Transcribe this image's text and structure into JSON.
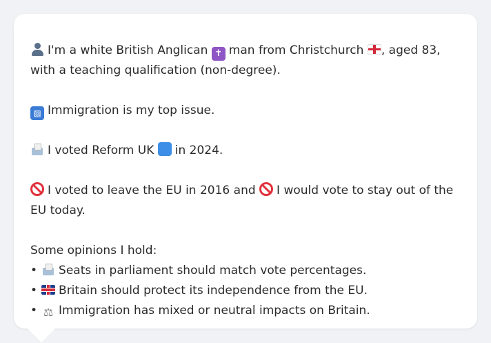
{
  "profile": {
    "line1_part1": "I'm a white British Anglican",
    "line1_part2": "man from Christchurch",
    "line1_part3": ", aged 83, with a teaching qualification (non-degree).",
    "issue": "Immigration is my top issue.",
    "vote_part1": "I voted Reform UK",
    "vote_part2": "in 2024.",
    "eu_part1": "I voted to leave the EU in 2016 and",
    "eu_part2": "I would vote to stay out of the EU today.",
    "opinions_heading": "Some opinions I hold:",
    "opinions": [
      {
        "icon": "ballot-box-icon",
        "text": "Seats in parliament should match vote percentages."
      },
      {
        "icon": "uk-flag-icon",
        "text": "Britain should protect its independence from the EU."
      },
      {
        "icon": "balance-scale-icon",
        "text": "Immigration has mixed or neutral impacts on Britain."
      }
    ],
    "bullet_char": "•",
    "scales_glyph": "⚖",
    "cross_glyph": "✝",
    "passport_glyph": "🛂"
  },
  "colors": {
    "background": "#f1f2f5",
    "card": "#ffffff",
    "text": "#2b2b2b",
    "prohibited": "#e0323c",
    "reform_blue": "#3d8ee6",
    "anglican_purple": "#8f55c4"
  }
}
